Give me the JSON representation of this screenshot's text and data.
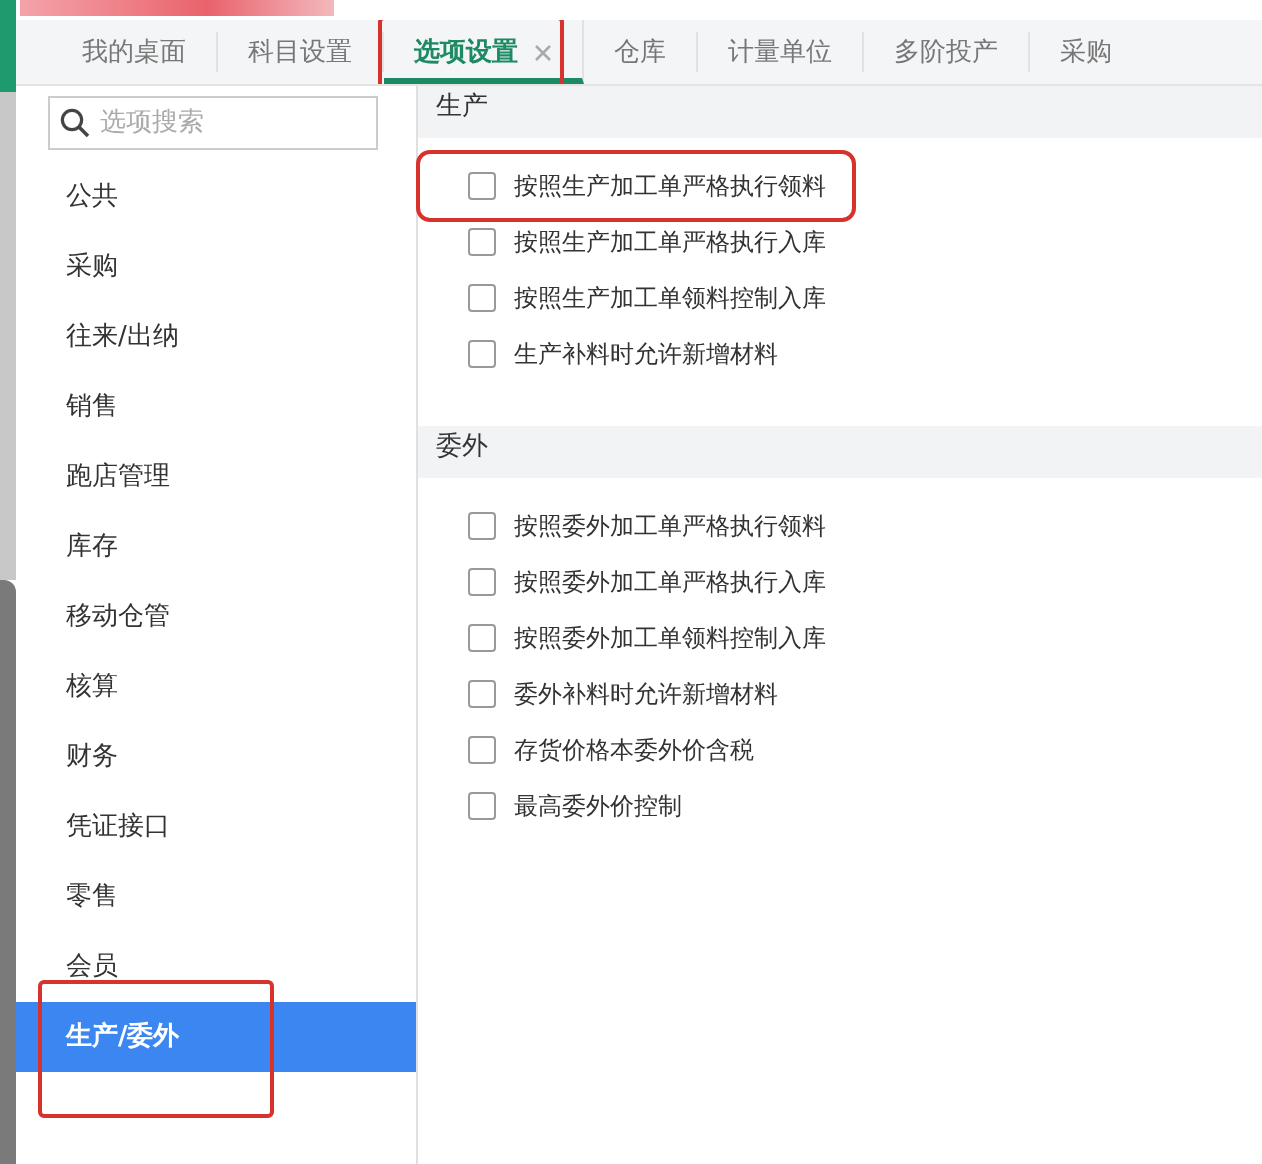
{
  "tabs": [
    {
      "label": "我的桌面",
      "selected": false,
      "closable": false,
      "highlighted": false
    },
    {
      "label": "科目设置",
      "selected": false,
      "closable": false,
      "highlighted": false
    },
    {
      "label": "选项设置",
      "selected": true,
      "closable": true,
      "highlighted": true
    },
    {
      "label": "仓库",
      "selected": false,
      "closable": false,
      "highlighted": false
    },
    {
      "label": "计量单位",
      "selected": false,
      "closable": false,
      "highlighted": false
    },
    {
      "label": "多阶投产",
      "selected": false,
      "closable": false,
      "highlighted": false
    },
    {
      "label": "采购",
      "selected": false,
      "closable": false,
      "highlighted": false
    }
  ],
  "search": {
    "placeholder": "选项搜索"
  },
  "sidebar": {
    "items": [
      {
        "label": "公共",
        "selected": false,
        "highlighted": false
      },
      {
        "label": "采购",
        "selected": false,
        "highlighted": false
      },
      {
        "label": "往来/出纳",
        "selected": false,
        "highlighted": false
      },
      {
        "label": "销售",
        "selected": false,
        "highlighted": false
      },
      {
        "label": "跑店管理",
        "selected": false,
        "highlighted": false
      },
      {
        "label": "库存",
        "selected": false,
        "highlighted": false
      },
      {
        "label": "移动仓管",
        "selected": false,
        "highlighted": false
      },
      {
        "label": "核算",
        "selected": false,
        "highlighted": false
      },
      {
        "label": "财务",
        "selected": false,
        "highlighted": false
      },
      {
        "label": "凭证接口",
        "selected": false,
        "highlighted": false
      },
      {
        "label": "零售",
        "selected": false,
        "highlighted": false
      },
      {
        "label": "会员",
        "selected": false,
        "highlighted": false
      },
      {
        "label": "生产/委外",
        "selected": true,
        "highlighted": true
      }
    ]
  },
  "sections": [
    {
      "title": "生产",
      "options": [
        {
          "label": "按照生产加工单严格执行领料",
          "checked": false,
          "highlighted": true
        },
        {
          "label": "按照生产加工单严格执行入库",
          "checked": false,
          "highlighted": false
        },
        {
          "label": "按照生产加工单领料控制入库",
          "checked": false,
          "highlighted": false
        },
        {
          "label": "生产补料时允许新增材料",
          "checked": false,
          "highlighted": false
        }
      ]
    },
    {
      "title": "委外",
      "options": [
        {
          "label": "按照委外加工单严格执行领料",
          "checked": false,
          "highlighted": false
        },
        {
          "label": "按照委外加工单严格执行入库",
          "checked": false,
          "highlighted": false
        },
        {
          "label": "按照委外加工单领料控制入库",
          "checked": false,
          "highlighted": false
        },
        {
          "label": "委外补料时允许新增材料",
          "checked": false,
          "highlighted": false
        },
        {
          "label": "存货价格本委外价含税",
          "checked": false,
          "highlighted": false
        },
        {
          "label": "最高委外价控制",
          "checked": false,
          "highlighted": false
        }
      ]
    }
  ]
}
